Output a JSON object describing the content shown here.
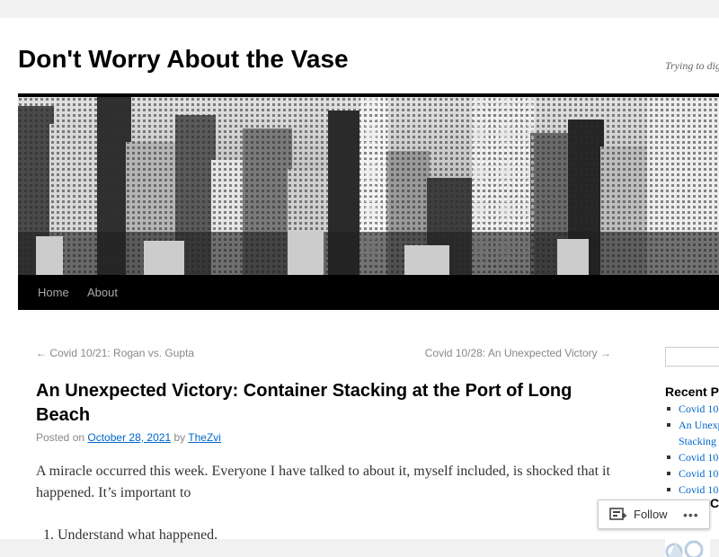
{
  "site": {
    "title": "Don't Worry About the Vase",
    "description": "Trying to dig"
  },
  "nav": {
    "items": [
      "Home",
      "About"
    ]
  },
  "post_nav": {
    "previous": "← Covid 10/21: Rogan vs. Gupta",
    "next": "Covid 10/28: An Unexpected Victory →"
  },
  "post": {
    "title": "An Unexpected Victory: Container Stacking at the Port of Long Beach",
    "meta_prefix": "Posted on",
    "date": "October 28, 2021",
    "meta_by": "by",
    "author": "TheZvi",
    "body": "A miracle occurred this week. Everyone I have talked to about it, myself included, is shocked that it happened. It’s important to",
    "list": [
      "Understand what happened."
    ]
  },
  "sidebar": {
    "recent_heading": "Recent P",
    "recent_posts": [
      "Covid 10",
      "An Unexp",
      "Stacking",
      "Covid 10",
      "Covid 10",
      "Covid 10"
    ],
    "second_heading": "C"
  },
  "follow": {
    "label": "Follow",
    "more": "•••",
    "icon": "follow-icon"
  },
  "colors": {
    "link": "#0066cc",
    "nav_bar": "#000000",
    "page_bg": "#f1f1f1"
  }
}
